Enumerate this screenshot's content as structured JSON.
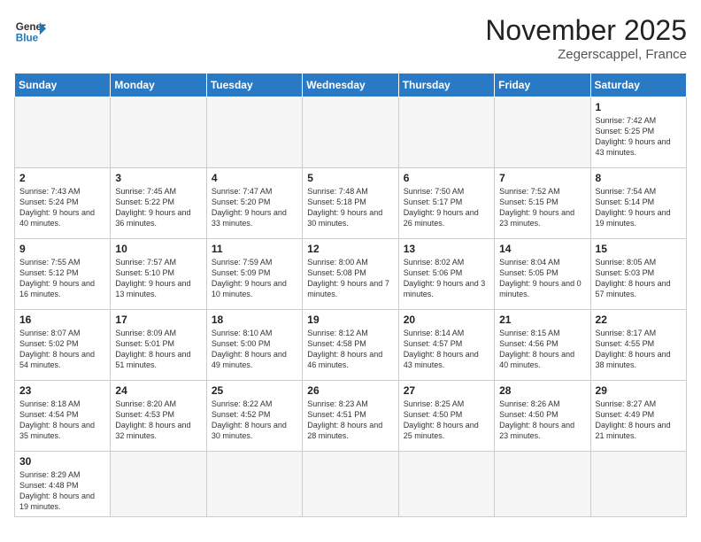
{
  "header": {
    "logo_general": "General",
    "logo_blue": "Blue",
    "month_title": "November 2025",
    "location": "Zegerscappel, France"
  },
  "weekdays": [
    "Sunday",
    "Monday",
    "Tuesday",
    "Wednesday",
    "Thursday",
    "Friday",
    "Saturday"
  ],
  "weeks": [
    [
      {
        "day": "",
        "empty": true
      },
      {
        "day": "",
        "empty": true
      },
      {
        "day": "",
        "empty": true
      },
      {
        "day": "",
        "empty": true
      },
      {
        "day": "",
        "empty": true
      },
      {
        "day": "",
        "empty": true
      },
      {
        "day": "1",
        "sunrise": "7:42 AM",
        "sunset": "5:25 PM",
        "daylight": "9 hours and 43 minutes."
      }
    ],
    [
      {
        "day": "2",
        "sunrise": "7:43 AM",
        "sunset": "5:24 PM",
        "daylight": "9 hours and 40 minutes."
      },
      {
        "day": "3",
        "sunrise": "7:45 AM",
        "sunset": "5:22 PM",
        "daylight": "9 hours and 36 minutes."
      },
      {
        "day": "4",
        "sunrise": "7:47 AM",
        "sunset": "5:20 PM",
        "daylight": "9 hours and 33 minutes."
      },
      {
        "day": "5",
        "sunrise": "7:48 AM",
        "sunset": "5:18 PM",
        "daylight": "9 hours and 30 minutes."
      },
      {
        "day": "6",
        "sunrise": "7:50 AM",
        "sunset": "5:17 PM",
        "daylight": "9 hours and 26 minutes."
      },
      {
        "day": "7",
        "sunrise": "7:52 AM",
        "sunset": "5:15 PM",
        "daylight": "9 hours and 23 minutes."
      },
      {
        "day": "8",
        "sunrise": "7:54 AM",
        "sunset": "5:14 PM",
        "daylight": "9 hours and 19 minutes."
      }
    ],
    [
      {
        "day": "9",
        "sunrise": "7:55 AM",
        "sunset": "5:12 PM",
        "daylight": "9 hours and 16 minutes."
      },
      {
        "day": "10",
        "sunrise": "7:57 AM",
        "sunset": "5:10 PM",
        "daylight": "9 hours and 13 minutes."
      },
      {
        "day": "11",
        "sunrise": "7:59 AM",
        "sunset": "5:09 PM",
        "daylight": "9 hours and 10 minutes."
      },
      {
        "day": "12",
        "sunrise": "8:00 AM",
        "sunset": "5:08 PM",
        "daylight": "9 hours and 7 minutes."
      },
      {
        "day": "13",
        "sunrise": "8:02 AM",
        "sunset": "5:06 PM",
        "daylight": "9 hours and 3 minutes."
      },
      {
        "day": "14",
        "sunrise": "8:04 AM",
        "sunset": "5:05 PM",
        "daylight": "9 hours and 0 minutes."
      },
      {
        "day": "15",
        "sunrise": "8:05 AM",
        "sunset": "5:03 PM",
        "daylight": "8 hours and 57 minutes."
      }
    ],
    [
      {
        "day": "16",
        "sunrise": "8:07 AM",
        "sunset": "5:02 PM",
        "daylight": "8 hours and 54 minutes."
      },
      {
        "day": "17",
        "sunrise": "8:09 AM",
        "sunset": "5:01 PM",
        "daylight": "8 hours and 51 minutes."
      },
      {
        "day": "18",
        "sunrise": "8:10 AM",
        "sunset": "5:00 PM",
        "daylight": "8 hours and 49 minutes."
      },
      {
        "day": "19",
        "sunrise": "8:12 AM",
        "sunset": "4:58 PM",
        "daylight": "8 hours and 46 minutes."
      },
      {
        "day": "20",
        "sunrise": "8:14 AM",
        "sunset": "4:57 PM",
        "daylight": "8 hours and 43 minutes."
      },
      {
        "day": "21",
        "sunrise": "8:15 AM",
        "sunset": "4:56 PM",
        "daylight": "8 hours and 40 minutes."
      },
      {
        "day": "22",
        "sunrise": "8:17 AM",
        "sunset": "4:55 PM",
        "daylight": "8 hours and 38 minutes."
      }
    ],
    [
      {
        "day": "23",
        "sunrise": "8:18 AM",
        "sunset": "4:54 PM",
        "daylight": "8 hours and 35 minutes."
      },
      {
        "day": "24",
        "sunrise": "8:20 AM",
        "sunset": "4:53 PM",
        "daylight": "8 hours and 32 minutes."
      },
      {
        "day": "25",
        "sunrise": "8:22 AM",
        "sunset": "4:52 PM",
        "daylight": "8 hours and 30 minutes."
      },
      {
        "day": "26",
        "sunrise": "8:23 AM",
        "sunset": "4:51 PM",
        "daylight": "8 hours and 28 minutes."
      },
      {
        "day": "27",
        "sunrise": "8:25 AM",
        "sunset": "4:50 PM",
        "daylight": "8 hours and 25 minutes."
      },
      {
        "day": "28",
        "sunrise": "8:26 AM",
        "sunset": "4:50 PM",
        "daylight": "8 hours and 23 minutes."
      },
      {
        "day": "29",
        "sunrise": "8:27 AM",
        "sunset": "4:49 PM",
        "daylight": "8 hours and 21 minutes."
      }
    ],
    [
      {
        "day": "30",
        "sunrise": "8:29 AM",
        "sunset": "4:48 PM",
        "daylight": "8 hours and 19 minutes."
      },
      {
        "day": "",
        "empty": true
      },
      {
        "day": "",
        "empty": true
      },
      {
        "day": "",
        "empty": true
      },
      {
        "day": "",
        "empty": true
      },
      {
        "day": "",
        "empty": true
      },
      {
        "day": "",
        "empty": true
      }
    ]
  ]
}
